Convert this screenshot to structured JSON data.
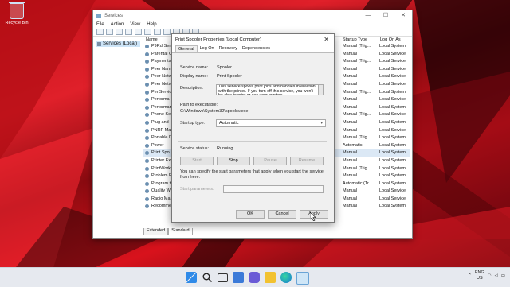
{
  "desktop": {
    "recycle_bin_label": "Recycle Bin"
  },
  "window": {
    "title": "Services",
    "menu": [
      "File",
      "Action",
      "View",
      "Help"
    ],
    "tree_node": "Services (Local)",
    "columns": [
      "Name",
      "Startup Type",
      "Log On As"
    ],
    "rows": [
      {
        "name": "P9RdrService",
        "startup": "Manual (Trig...",
        "logon": "Local System"
      },
      {
        "name": "Parental C",
        "startup": "Manual",
        "logon": "Local Service"
      },
      {
        "name": "Payments",
        "startup": "Manual (Trig...",
        "logon": "Local Service"
      },
      {
        "name": "Peer Nam",
        "startup": "Manual",
        "logon": "Local Service"
      },
      {
        "name": "Peer Netw",
        "startup": "Manual",
        "logon": "Local Service"
      },
      {
        "name": "Peer Netw",
        "startup": "Manual",
        "logon": "Local Service"
      },
      {
        "name": "PenService",
        "startup": "Manual (Trig...",
        "logon": "Local System"
      },
      {
        "name": "Performa",
        "startup": "Manual",
        "logon": "Local Service"
      },
      {
        "name": "Performan",
        "startup": "Manual",
        "logon": "Local System"
      },
      {
        "name": "Phone Se",
        "startup": "Manual (Trig...",
        "logon": "Local Service"
      },
      {
        "name": "Plug and",
        "startup": "Manual",
        "logon": "Local System"
      },
      {
        "name": "PNRP Ma",
        "startup": "Manual",
        "logon": "Local Service"
      },
      {
        "name": "Portable D",
        "startup": "Manual (Trig...",
        "logon": "Local System"
      },
      {
        "name": "Power",
        "startup": "Automatic",
        "logon": "Local System"
      },
      {
        "name": "Print Spo",
        "startup": "Manual",
        "logon": "Local System"
      },
      {
        "name": "Printer Ex",
        "startup": "Manual",
        "logon": "Local System"
      },
      {
        "name": "PrintWork",
        "startup": "Manual (Trig...",
        "logon": "Local System"
      },
      {
        "name": "Problem R",
        "startup": "Manual",
        "logon": "Local System"
      },
      {
        "name": "Program t",
        "startup": "Automatic (Tr...",
        "logon": "Local System"
      },
      {
        "name": "Quality W",
        "startup": "Manual",
        "logon": "Local Service"
      },
      {
        "name": "Radio Ma",
        "startup": "Manual",
        "logon": "Local Service"
      },
      {
        "name": "Recomme",
        "startup": "Manual",
        "logon": "Local System"
      }
    ],
    "tabs": [
      "Extended",
      "Standard"
    ]
  },
  "dialog": {
    "title": "Print Spooler Properties (Local Computer)",
    "tabs": [
      "General",
      "Log On",
      "Recovery",
      "Dependencies"
    ],
    "service_name_label": "Service name:",
    "service_name": "Spooler",
    "display_name_label": "Display name:",
    "display_name": "Print Spooler",
    "description_label": "Description:",
    "description": "This service spools print jobs and handles interaction with the printer. If you turn off this service, you won't be able to print or see your printers.",
    "path_label": "Path to executable:",
    "path": "C:\\Windows\\System32\\spoolsv.exe",
    "startup_type_label": "Startup type:",
    "startup_type": "Automatic",
    "status_label": "Service status:",
    "status": "Running",
    "start_btn": "Start",
    "stop_btn": "Stop",
    "pause_btn": "Pause",
    "resume_btn": "Resume",
    "params_hint": "You can specify the start parameters that apply when you start the service from here.",
    "params_label": "Start parameters:",
    "ok_btn": "OK",
    "cancel_btn": "Cancel",
    "apply_btn": "Apply"
  },
  "taskbar": {
    "lang_top": "ENG",
    "lang_bottom": "US",
    "icons": [
      "windows-start-icon",
      "search-icon",
      "task-view-icon",
      "widgets-icon",
      "chat-icon",
      "file-explorer-icon",
      "edge-icon",
      "store-icon"
    ]
  },
  "colors": {
    "accent": "#0067c0",
    "selection": "#cce4f7"
  }
}
